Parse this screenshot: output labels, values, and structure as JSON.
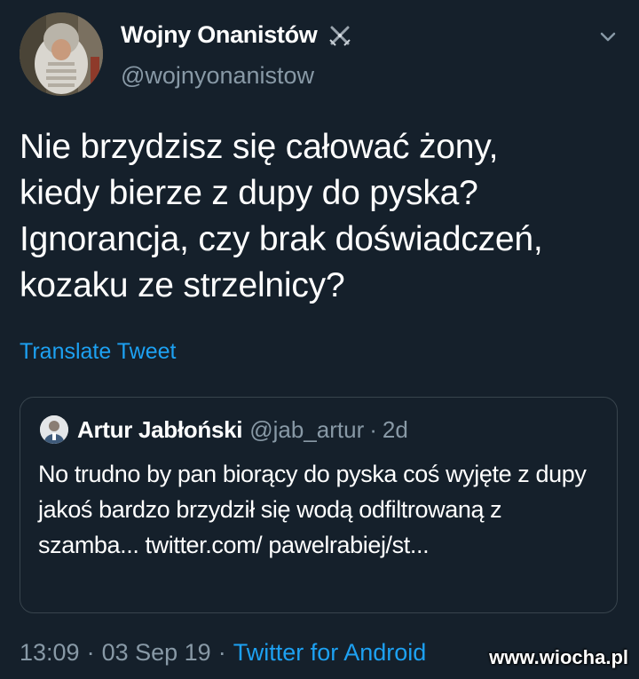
{
  "author": {
    "display_name": "Wojny Onanistów",
    "handle": "@wojnyonanistow",
    "avatar_icon": "knight-helmet-avatar",
    "badge_icon": "crossed-swords-icon"
  },
  "tweet": {
    "text": "Nie brzydzisz się całować żony,\nkiedy bierze z dupy do pyska?\nIgnorancja, czy brak doświadczeń,\nkozaku ze strzelnicy?",
    "translate_label": "Translate Tweet"
  },
  "quoted_tweet": {
    "display_name": "Artur Jabłoński",
    "handle": "@jab_artur",
    "separator": "·",
    "time": "2d",
    "text": "No trudno by pan biorący do pyska coś wyjęte z dupy jakoś bardzo brzydził się wodą odfiltrowaną z szamba... twitter.com/ pawelrabiej/st..."
  },
  "footer": {
    "time": "13:09",
    "separator": "·",
    "date": "03 Sep 19",
    "source": "Twitter for Android"
  },
  "watermark": "www.wiocha.pl",
  "colors": {
    "background": "#15202b",
    "text": "#ffffff",
    "secondary": "#8899a6",
    "accent": "#1da1f2",
    "border": "#38444d"
  }
}
